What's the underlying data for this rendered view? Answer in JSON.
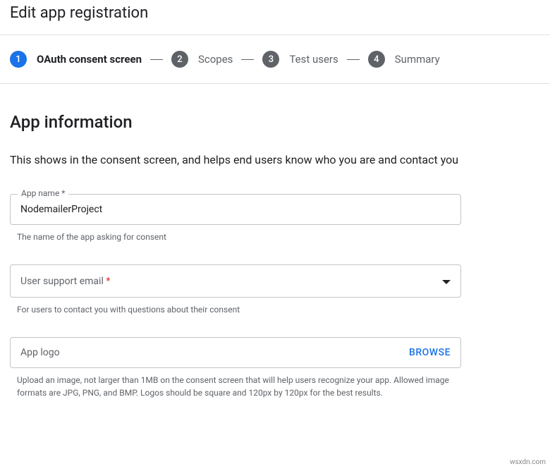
{
  "page_title": "Edit app registration",
  "stepper": {
    "steps": [
      {
        "num": "1",
        "label": "OAuth consent screen",
        "active": true
      },
      {
        "num": "2",
        "label": "Scopes",
        "active": false
      },
      {
        "num": "3",
        "label": "Test users",
        "active": false
      },
      {
        "num": "4",
        "label": "Summary",
        "active": false
      }
    ]
  },
  "section": {
    "heading": "App information",
    "description": "This shows in the consent screen, and helps end users know who you are and contact you"
  },
  "fields": {
    "app_name": {
      "label": "App name *",
      "value": "NodemailerProject",
      "helper": "The name of the app asking for consent"
    },
    "support_email": {
      "placeholder": "User support email",
      "required_marker": "*",
      "helper": "For users to contact you with questions about their consent"
    },
    "app_logo": {
      "placeholder": "App logo",
      "browse_label": "BROWSE",
      "helper": "Upload an image, not larger than 1MB on the consent screen that will help users recognize your app. Allowed image formats are JPG, PNG, and BMP. Logos should be square and 120px by 120px for the best results."
    }
  },
  "watermark": "wsxdn.com"
}
